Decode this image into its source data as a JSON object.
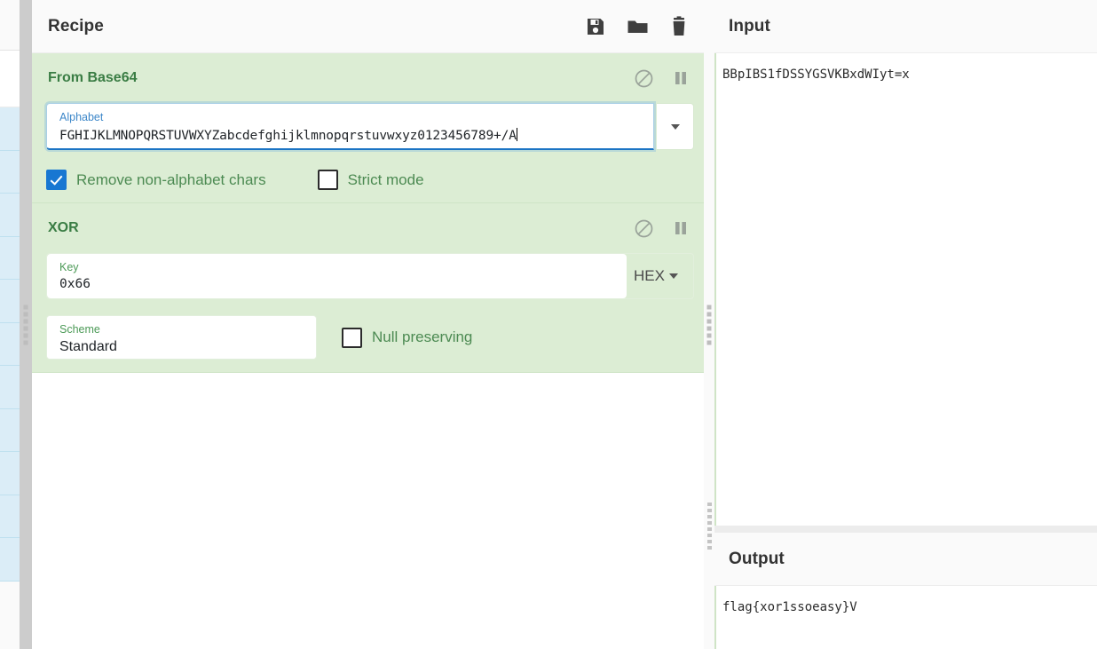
{
  "recipe": {
    "title": "Recipe",
    "controls": [
      {
        "name": "save-icon",
        "label": "Save recipe"
      },
      {
        "name": "folder-icon",
        "label": "Load recipe"
      },
      {
        "name": "trash-icon",
        "label": "Clear recipe"
      }
    ],
    "operations": [
      {
        "title": "From Base64",
        "disable_label": "Disable operation",
        "breakpoint_label": "Set breakpoint",
        "alphabet": {
          "label": "Alphabet",
          "value": "FGHIJKLMNOPQRSTUVWXYZabcdefghijklmnopqrstuvwxyz0123456789+/A"
        },
        "remove_non_alphabet": {
          "label": "Remove non-alphabet chars",
          "checked": true
        },
        "strict_mode": {
          "label": "Strict mode",
          "checked": false
        }
      },
      {
        "title": "XOR",
        "disable_label": "Disable operation",
        "breakpoint_label": "Set breakpoint",
        "key": {
          "label": "Key",
          "value": "0x66",
          "type": "HEX"
        },
        "scheme": {
          "label": "Scheme",
          "value": "Standard"
        },
        "null_preserving": {
          "label": "Null preserving",
          "checked": false
        }
      }
    ]
  },
  "input": {
    "title": "Input",
    "value": "BBpIBS1fDSSYGSVKBxdWIyt=x"
  },
  "output": {
    "title": "Output",
    "value": "flag{xor1ssoeasy}V"
  },
  "colors": {
    "operation_bg": "#dcedd4",
    "operation_title": "#3a7d44",
    "checkbox_checked": "#1877d2",
    "focus_border": "#1b74c4",
    "panel_header_bg": "#fafafa"
  }
}
